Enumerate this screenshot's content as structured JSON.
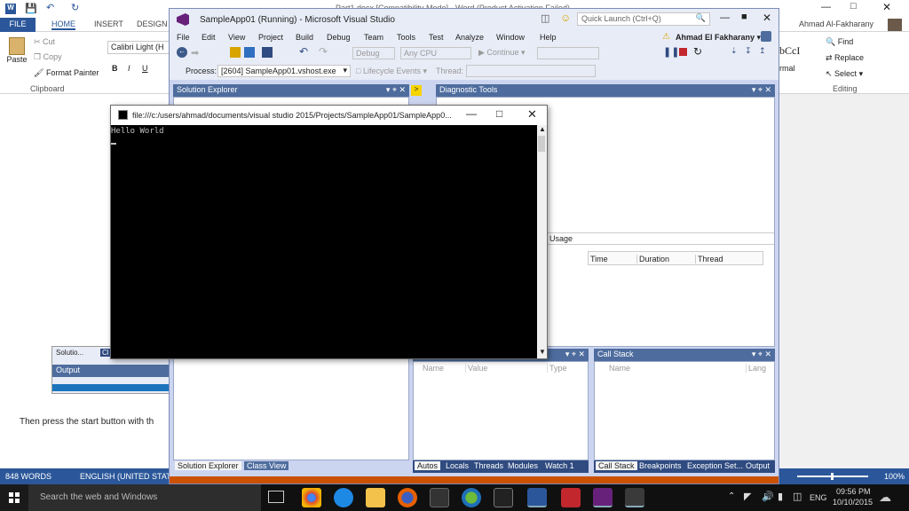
{
  "word": {
    "title": "Part1.docx [Compatibility Mode] - Word (Product Activation Failed)",
    "tabs": [
      "FILE",
      "HOME",
      "INSERT",
      "DESIGN"
    ],
    "user": "Ahmad Al-Fakharany",
    "clipboard": {
      "paste": "Paste",
      "cut": "Cut",
      "copy": "Copy",
      "format_painter": "Format Painter",
      "group": "Clipboard"
    },
    "font": {
      "name": "Calibri Light (H",
      "bold": "B",
      "italic": "I",
      "underline": "U"
    },
    "styles_preview": "bCcI",
    "style_name": "rmal",
    "editing": {
      "find": "Find",
      "replace": "Replace",
      "select": "Select",
      "group": "Editing"
    },
    "doc_text": "Then press the start button with th",
    "status": {
      "words": "848 WORDS",
      "language": "ENGLISH (UNITED STATES)",
      "zoom": "100%"
    },
    "side_tab_labels": [
      "Solutio...",
      "Cl"
    ],
    "side_output": "Output"
  },
  "vs": {
    "title": "SampleApp01 (Running) - Microsoft Visual Studio",
    "quick_launch_placeholder": "Quick Launch (Ctrl+Q)",
    "menu": [
      "File",
      "Edit",
      "View",
      "Project",
      "Build",
      "Debug",
      "Team",
      "Tools",
      "Test",
      "Analyze",
      "Window",
      "Help"
    ],
    "user": "Ahmad El Fakharany",
    "toolbar": {
      "config": "Debug",
      "platform": "Any CPU",
      "continue": "Continue"
    },
    "process_label": "Process:",
    "process_value": "[2604] SampleApp01.vshost.exe",
    "lifecycle": "Lifecycle Events",
    "thread_label": "Thread:",
    "solution_explorer": "Solution Explorer",
    "diagnostic_tools": "Diagnostic Tools",
    "usage": "U Usage",
    "events_columns": [
      "Time",
      "Duration",
      "Thread"
    ],
    "locals_columns": [
      "Name",
      "Value",
      "Type"
    ],
    "call_stack": "Call Stack",
    "call_stack_columns": [
      "Name",
      "Lang"
    ],
    "bottom_left_tabs": [
      "Solution Explorer",
      "Class View"
    ],
    "bottom_mid_tabs": [
      "Autos",
      "Locals",
      "Threads",
      "Modules",
      "Watch 1"
    ],
    "bottom_right_tabs": [
      "Call Stack",
      "Breakpoints",
      "Exception Set...",
      "Output"
    ]
  },
  "console": {
    "title": "file:///c:/users/ahmad/documents/visual studio 2015/Projects/SampleApp01/SampleApp0...",
    "output": "Hello World"
  },
  "taskbar": {
    "search_placeholder": "Search the web and Windows",
    "language": "ENG",
    "time": "09:56 PM",
    "date": "10/10/2015"
  }
}
